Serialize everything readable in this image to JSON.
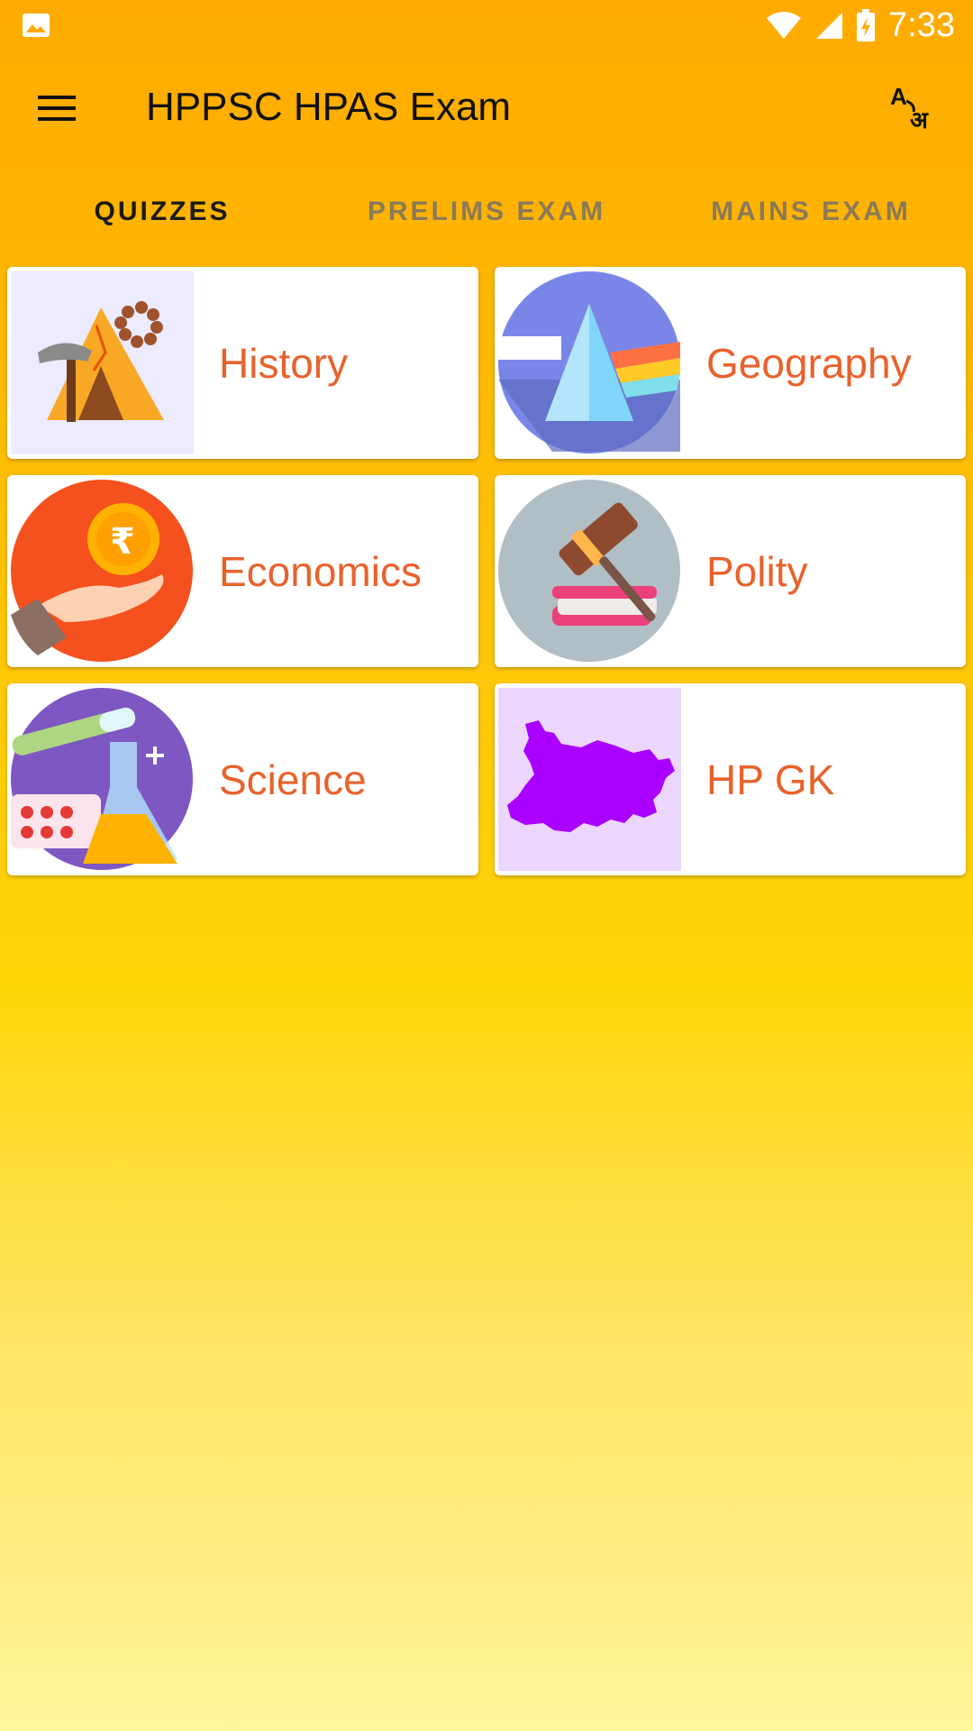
{
  "status_bar": {
    "time": "7:33"
  },
  "toolbar": {
    "title": "HPPSC HPAS Exam"
  },
  "tabs": [
    {
      "label": "QUIZZES",
      "active": true
    },
    {
      "label": "PRELIMS EXAM",
      "active": false
    },
    {
      "label": "MAINS EXAM",
      "active": false
    }
  ],
  "categories": [
    {
      "label": "History",
      "icon": "history-icon"
    },
    {
      "label": "Geography",
      "icon": "geography-icon"
    },
    {
      "label": "Economics",
      "icon": "economics-icon"
    },
    {
      "label": "Polity",
      "icon": "polity-icon"
    },
    {
      "label": "Science",
      "icon": "science-icon"
    },
    {
      "label": "HP GK",
      "icon": "hp-gk-icon"
    }
  ],
  "colors": {
    "accent": "#FFB300",
    "label": "#E8622C"
  }
}
